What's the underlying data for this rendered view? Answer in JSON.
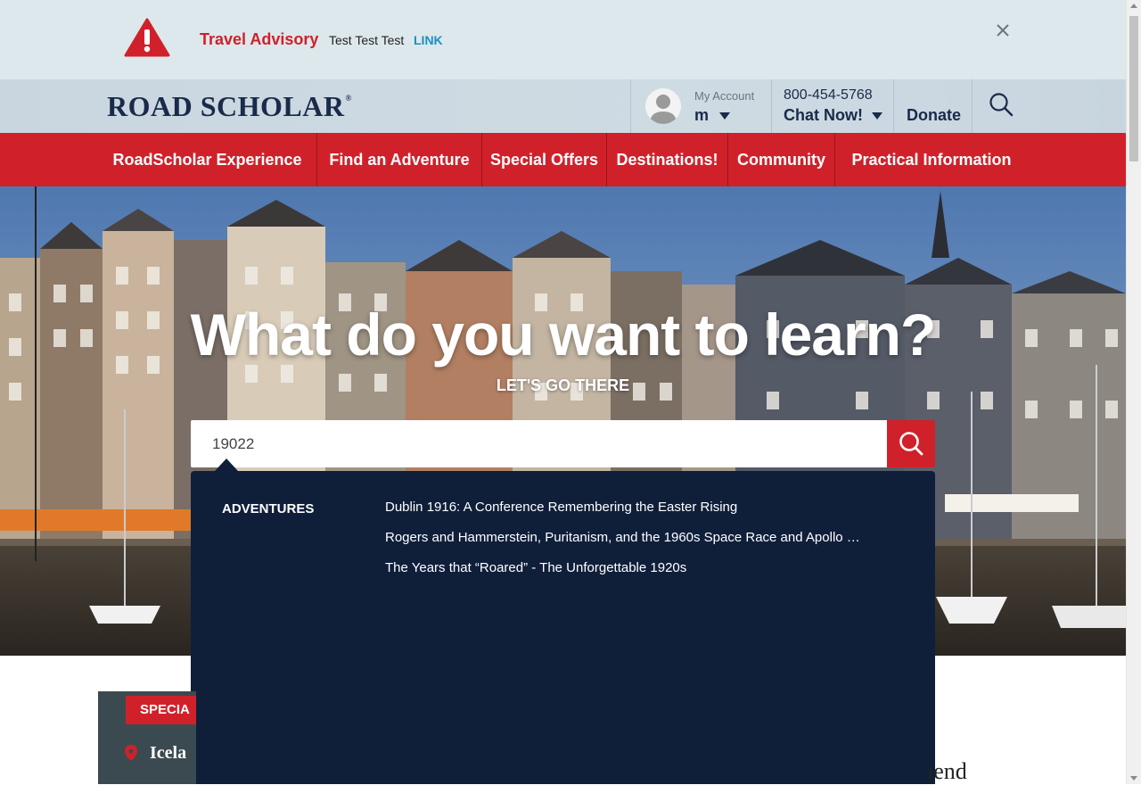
{
  "advisory": {
    "title": "Travel Advisory",
    "text": "Test Test Test",
    "link": "LINK",
    "icon": "warning-icon",
    "close_icon": "close-icon"
  },
  "header": {
    "logo": "ROAD SCHOLAR",
    "logo_mark": "®",
    "account_label": "My Account",
    "account_name": "m",
    "phone": "800-454-5768",
    "chat": "Chat Now!",
    "donate": "Donate",
    "search_icon": "search-icon"
  },
  "nav": {
    "items": [
      "RoadScholar Experience",
      "Find an Adventure",
      "Special Offers",
      "Destinations!",
      "Community",
      "Practical Information"
    ]
  },
  "hero": {
    "title": "What do you want to learn?",
    "subtitle": "LET'S GO THERE",
    "search_value": "19022"
  },
  "dropdown": {
    "category": "ADVENTURES",
    "items": [
      "Dublin 1916: A Conference Remembering the Easter Rising",
      "Rogers and Hammerstein, Puritanism, and the 1960s Space Race and Apollo Missi…",
      "The Years that “Roared” - The Unforgettable 1920s"
    ]
  },
  "promo": {
    "badge": "SPECIA",
    "location": "Icela"
  },
  "below": {
    "partial_text": "iend"
  },
  "colors": {
    "brand_red": "#d0212a",
    "navy": "#0f1f3a",
    "advisory_bg": "#dde8ec",
    "link_blue": "#1a8fc2"
  }
}
